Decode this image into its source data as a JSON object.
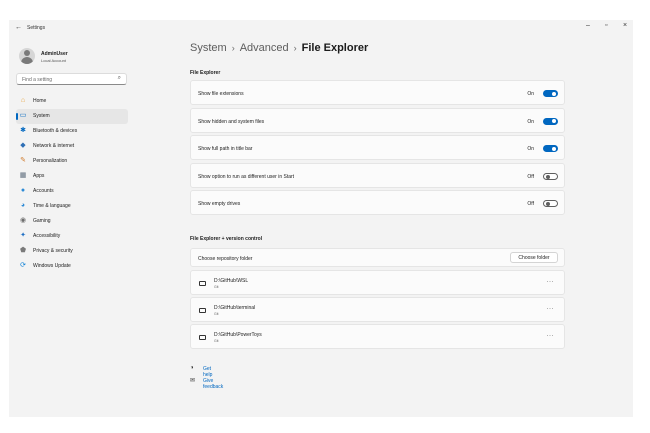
{
  "window": {
    "title": "Settings",
    "controls": {
      "minimize": "–",
      "maximize": "▫",
      "close": "×"
    }
  },
  "user": {
    "name": "AdminUser",
    "account": "Local Account"
  },
  "search": {
    "placeholder": "Find a setting"
  },
  "sidebar": {
    "items": [
      {
        "label": "Home",
        "icon": "home-icon",
        "glyph": "⌂",
        "color": "#e8a33c"
      },
      {
        "label": "System",
        "icon": "system-icon",
        "glyph": "▭",
        "color": "#0067c0",
        "active": true
      },
      {
        "label": "Bluetooth & devices",
        "icon": "bluetooth-icon",
        "glyph": "✱",
        "color": "#0067c0"
      },
      {
        "label": "Network & internet",
        "icon": "network-icon",
        "glyph": "◆",
        "color": "#2f6fb5"
      },
      {
        "label": "Personalization",
        "icon": "brush-icon",
        "glyph": "✎",
        "color": "#d07a2a"
      },
      {
        "label": "Apps",
        "icon": "apps-icon",
        "glyph": "▦",
        "color": "#5b6b7a"
      },
      {
        "label": "Accounts",
        "icon": "accounts-icon",
        "glyph": "●",
        "color": "#2e8bd6"
      },
      {
        "label": "Time & language",
        "icon": "globe-clock-icon",
        "glyph": "◕",
        "color": "#2e8bd6"
      },
      {
        "label": "Gaming",
        "icon": "gamepad-icon",
        "glyph": "◉",
        "color": "#6e6e6e"
      },
      {
        "label": "Accessibility",
        "icon": "accessibility-icon",
        "glyph": "✦",
        "color": "#1f6fc4"
      },
      {
        "label": "Privacy & security",
        "icon": "shield-icon",
        "glyph": "⬟",
        "color": "#7a7a7a"
      },
      {
        "label": "Windows Update",
        "icon": "update-icon",
        "glyph": "⟳",
        "color": "#0b7fd6"
      }
    ]
  },
  "breadcrumb": {
    "crumb1": "System",
    "crumb2": "Advanced",
    "current": "File Explorer",
    "separator": "›"
  },
  "section1": {
    "title": "File Explorer",
    "settings": [
      {
        "label": "Show file extensions",
        "state": "On",
        "on": true
      },
      {
        "label": "Show hidden and system files",
        "state": "On",
        "on": true
      },
      {
        "label": "Show full path in title bar",
        "state": "On",
        "on": true
      },
      {
        "label": "Show option to run as different user in Start",
        "state": "Off",
        "on": false
      },
      {
        "label": "Show empty drives",
        "state": "Off",
        "on": false
      }
    ]
  },
  "section2": {
    "title": "File Explorer + version control",
    "choose_label": "Choose repository folder",
    "choose_button": "Choose folder",
    "repos": [
      {
        "path": "D:\\GitHub\\WSL",
        "type": "Git"
      },
      {
        "path": "D:\\GitHub\\terminal",
        "type": "Git"
      },
      {
        "path": "D:\\GitHub\\PowerToys",
        "type": "Git"
      }
    ],
    "more": "···"
  },
  "links": {
    "help": {
      "label": "Get help",
      "icon": "help-icon",
      "glyph": "◑"
    },
    "feedback": {
      "label": "Give feedback",
      "icon": "feedback-icon",
      "glyph": "✉"
    }
  },
  "colors": {
    "accent": "#0067c0",
    "background": "#f3f3f3",
    "card": "#fbfbfb"
  }
}
